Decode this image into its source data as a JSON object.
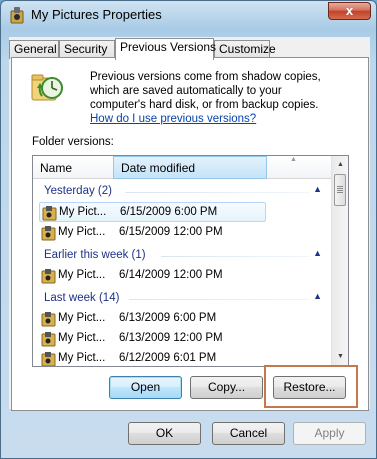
{
  "window": {
    "title": "My Pictures Properties",
    "close_label": "x"
  },
  "tabs": [
    {
      "label": "General",
      "active": false
    },
    {
      "label": "Security",
      "active": false
    },
    {
      "label": "Previous Versions",
      "active": true
    },
    {
      "label": "Customize",
      "active": false
    }
  ],
  "info": {
    "text": "Previous versions come from shadow copies, which are saved automatically to your computer's hard disk, or from backup copies.",
    "link": "How do I use previous versions?"
  },
  "folder_versions_label": "Folder versions:",
  "columns": {
    "name": "Name",
    "date_modified": "Date modified"
  },
  "groups": [
    {
      "label": "Yesterday (2)",
      "items": [
        {
          "name": "My Pict...",
          "date": "6/15/2009 6:00 PM",
          "selected": true
        },
        {
          "name": "My Pict...",
          "date": "6/15/2009 12:00 PM",
          "selected": false
        }
      ]
    },
    {
      "label": "Earlier this week (1)",
      "items": [
        {
          "name": "My Pict...",
          "date": "6/14/2009 12:00 PM",
          "selected": false
        }
      ]
    },
    {
      "label": "Last week (14)",
      "items": [
        {
          "name": "My Pict...",
          "date": "6/13/2009 6:00 PM",
          "selected": false
        },
        {
          "name": "My Pict...",
          "date": "6/13/2009 12:00 PM",
          "selected": false
        },
        {
          "name": "My Pict...",
          "date": "6/12/2009 6:01 PM",
          "selected": false
        }
      ]
    }
  ],
  "actions": {
    "open": "Open",
    "copy": "Copy...",
    "restore": "Restore..."
  },
  "dialog_buttons": {
    "ok": "OK",
    "cancel": "Cancel",
    "apply": "Apply"
  },
  "colors": {
    "highlight_box": "#c5784a",
    "group_text": "#1e3287",
    "link": "#0645ad"
  }
}
